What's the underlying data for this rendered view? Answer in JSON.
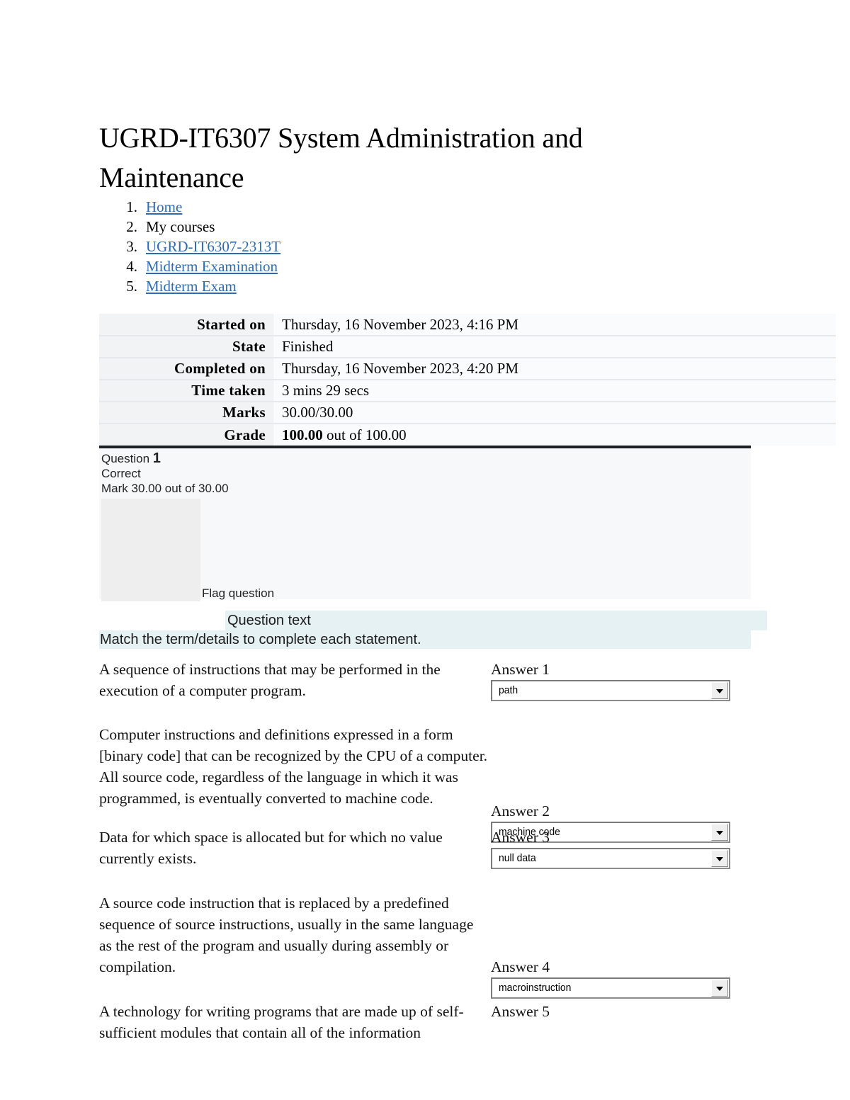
{
  "page": {
    "title": "UGRD-IT6307 System Administration and Maintenance"
  },
  "breadcrumb": {
    "items": [
      {
        "index": "1.",
        "label": "Home",
        "link": true
      },
      {
        "index": "2.",
        "label": "My courses",
        "link": false
      },
      {
        "index": "3.",
        "label": "UGRD-IT6307-2313T",
        "link": true
      },
      {
        "index": "4.",
        "label": "Midterm Examination",
        "link": true
      },
      {
        "index": "5.",
        "label": "Midterm Exam",
        "link": true
      }
    ]
  },
  "summary": {
    "rows": [
      {
        "label": "Started on",
        "value": "Thursday, 16 November 2023, 4:16 PM"
      },
      {
        "label": "State",
        "value": "Finished"
      },
      {
        "label": "Completed on",
        "value": "Thursday, 16 November 2023, 4:20 PM"
      },
      {
        "label": "Time taken",
        "value": "3 mins 29 secs"
      },
      {
        "label": "Marks",
        "value": "30.00/30.00"
      },
      {
        "label": "Grade",
        "value_bold": "100.00",
        "value_rest": " out of 100.00"
      }
    ]
  },
  "question": {
    "label": "Question",
    "number": "1",
    "state": "Correct",
    "mark": "Mark 30.00 out of 30.00",
    "flag_label": "Flag question",
    "question_text_label": "Question text",
    "question_text_body": "Match the term/details to complete each statement."
  },
  "matching": {
    "rows": [
      {
        "statement": "A sequence of instructions that may be performed in the execution of a computer program.",
        "answer_label": "Answer 1",
        "selected": "path",
        "has_select": true
      },
      {
        "statement": "Computer instructions and definitions expressed in a form [binary code] that can be recognized by the CPU of a computer. All source code, regardless of the language in which it was programmed, is eventually converted to machine code.",
        "answer_label": "Answer 2",
        "selected": "machine code",
        "has_select": true
      },
      {
        "statement": "Data for which space is allocated but for which no value currently exists.",
        "answer_label": "Answer 3",
        "selected": "null data",
        "has_select": true
      },
      {
        "statement": "A source code instruction that is replaced by a predefined sequence of source instructions, usually in the same language as the rest of the program and usually during assembly or compilation.",
        "answer_label": "Answer 4",
        "selected": "macroinstruction",
        "has_select": true
      },
      {
        "statement": "A technology for writing programs that are made up of self-sufficient modules that contain all of the information",
        "answer_label": "Answer 5",
        "selected": "",
        "has_select": false
      }
    ]
  },
  "colors": {
    "link": "#2b6cb9",
    "question_band": "#e6f1f4",
    "question_panel": "#f6f8fa",
    "table_label_bg": "#f1f3f4"
  }
}
